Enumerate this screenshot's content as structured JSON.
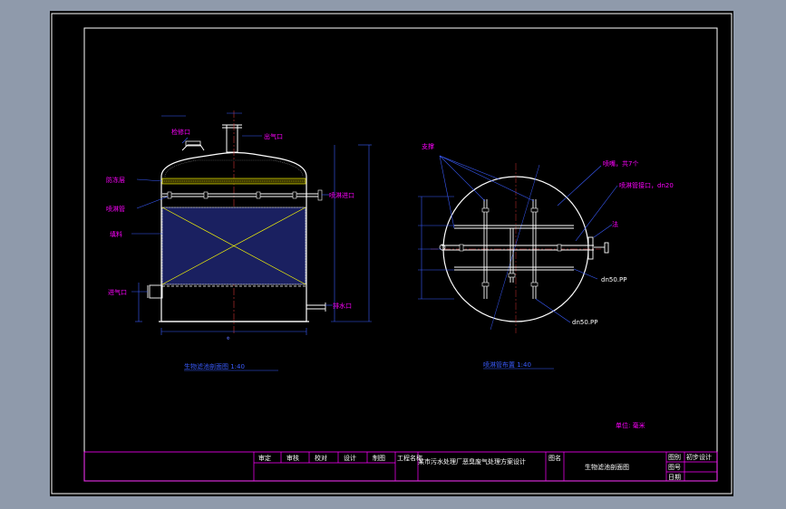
{
  "colors": {
    "background": "#000000",
    "frame": "#ffffff",
    "title_block": "#ff00ff",
    "tank_outline": "#ffffff",
    "dimension": "#3a5cff",
    "diagonal": "#ffff00",
    "fill_media": "#1a2060",
    "callout": "#ff00ff"
  },
  "section_view": {
    "labels": {
      "manhole": "检修口",
      "gas_outlet_top": "出气口",
      "layer": "防冻层",
      "spray_pipe": "喷淋管",
      "packing": "填料",
      "gas_inlet": "进气口",
      "spray_inlet": "喷淋进口",
      "drain": "排水口"
    },
    "caption": "生物滤池剖面图 1:40"
  },
  "plan_view": {
    "labels": {
      "support": "支撑",
      "holes": "喷嘴，共7个",
      "spray_header": "喷淋管接口，dn20",
      "flange": "法",
      "pipe_dn50": "dn50.PP",
      "pipe_dn50_2": "dn50.PP"
    },
    "caption": "喷淋管布置 1:40"
  },
  "unit_note": "单位: 毫米",
  "title_block": {
    "roles": [
      "审定",
      "审核",
      "校对",
      "设计",
      "制图"
    ],
    "project_label": "工程名称",
    "project_name": "某市污水处理厂恶臭废气处理方案设计",
    "drawing_label": "图名",
    "drawing_name": "生物滤池剖面图",
    "right": {
      "row1_label": "图别",
      "row1_value": "初步设计",
      "row2_label": "图号",
      "row3_label": "日期"
    }
  }
}
